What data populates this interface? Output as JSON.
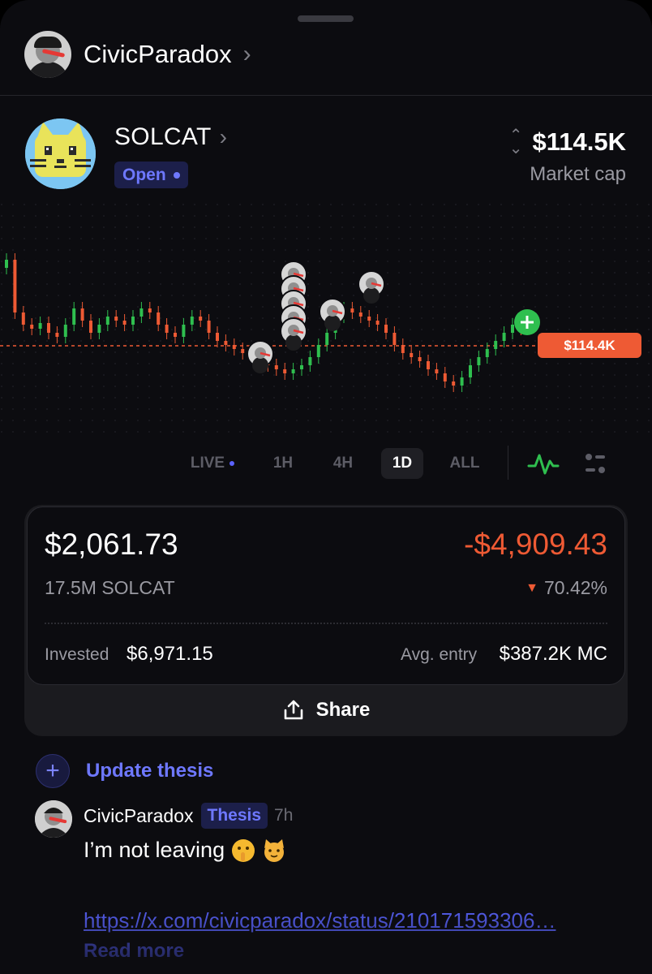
{
  "profile": {
    "name": "CivicParadox",
    "avatar_icon": "laser-eyes-avatar-icon"
  },
  "token": {
    "name": "SOLCAT",
    "status": "Open",
    "market_cap_value": "$114.5K",
    "market_cap_label": "Market cap",
    "icon": "pixel-cat-icon"
  },
  "chart": {
    "current_price_tag": "$114.4K",
    "candle_colors": {
      "up": "#2fbf4f",
      "down": "#ee5a34"
    },
    "ranges": [
      "LIVE",
      "1H",
      "4H",
      "1D",
      "ALL"
    ],
    "active_range": "1D"
  },
  "position": {
    "value": "$2,061.73",
    "pnl": "-$4,909.43",
    "quantity": "17.5M SOLCAT",
    "pnl_percent": "70.42%",
    "invested_label": "Invested",
    "invested_value": "$6,971.15",
    "avg_entry_label": "Avg. entry",
    "avg_entry_value": "$387.2K MC",
    "share_label": "Share"
  },
  "thesis": {
    "update_label": "Update thesis"
  },
  "post": {
    "author": "CivicParadox",
    "badge": "Thesis",
    "time": "7h",
    "text": "I’m not leaving",
    "link": "https://x.com/civicparadox/status/210171593306…",
    "read_more": "Read more"
  },
  "colors": {
    "accent": "#6e78ff",
    "negative": "#ee5a34",
    "positive": "#2fbf4f",
    "background": "#0c0c10"
  }
}
